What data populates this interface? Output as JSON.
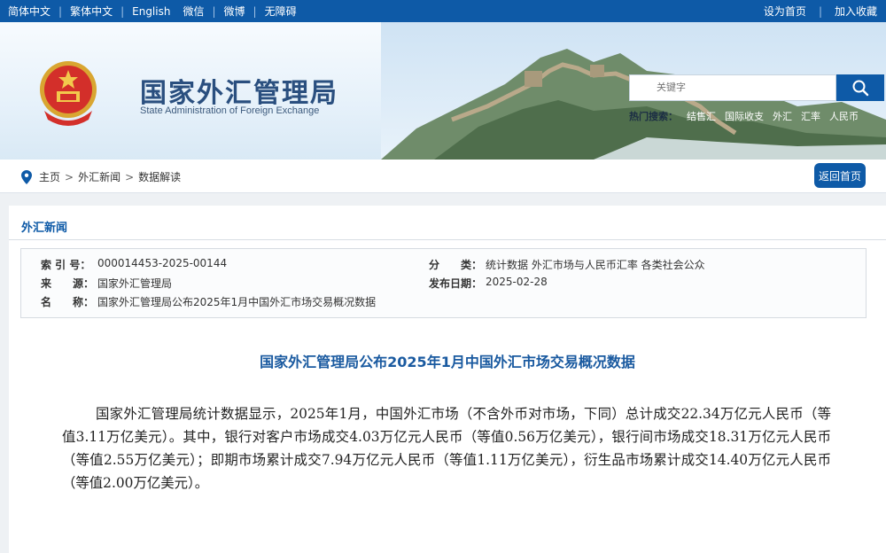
{
  "topbar": {
    "lang_links": [
      "简体中文",
      "繁体中文",
      "English",
      "微信",
      "微博",
      "无障碍"
    ],
    "right_links": [
      "设为首页",
      "加入收藏"
    ]
  },
  "header": {
    "site_title": "国家外汇管理局",
    "site_subtitle": "State Administration of Foreign Exchange",
    "search_placeholder": "关键字",
    "hot_label": "热门搜索：",
    "hot_terms": [
      "结售汇",
      "国际收支",
      "外汇",
      "汇率",
      "人民币"
    ]
  },
  "breadcrumb": {
    "items": [
      "主页",
      "外汇新闻",
      "数据解读"
    ],
    "back_button": "返回首页"
  },
  "section": {
    "title": "外汇新闻"
  },
  "meta": {
    "index_key": "索 引 号：",
    "index_value": "000014453-2025-00144",
    "category_key": "分　　类：",
    "category_value": "统计数据  外汇市场与人民币汇率  各类社会公众",
    "source_key": "来　　源：",
    "source_value": "国家外汇管理局",
    "date_key": "发布日期：",
    "date_value": "2025-02-28",
    "name_key": "名　　称：",
    "name_value": "国家外汇管理局公布2025年1月中国外汇市场交易概况数据"
  },
  "article": {
    "title": "国家外汇管理局公布2025年1月中国外汇市场交易概况数据",
    "body": "国家外汇管理局统计数据显示，2025年1月，中国外汇市场（不含外币对市场，下同）总计成交22.34万亿元人民币（等值3.11万亿美元）。其中，银行对客户市场成交4.03万亿元人民币（等值0.56万亿美元），银行间市场成交18.31万亿元人民币（等值2.55万亿美元）；即期市场累计成交7.94万亿元人民币（等值1.11万亿美元），衍生品市场累计成交14.40万亿元人民币（等值2.00万亿美元）。"
  },
  "colors": {
    "brand_blue": "#0e5aa7",
    "title_blue": "#1a5aa0",
    "page_bg": "#eef1f4"
  },
  "icons": [
    "national-emblem-icon",
    "search-icon",
    "location-pin-icon"
  ]
}
